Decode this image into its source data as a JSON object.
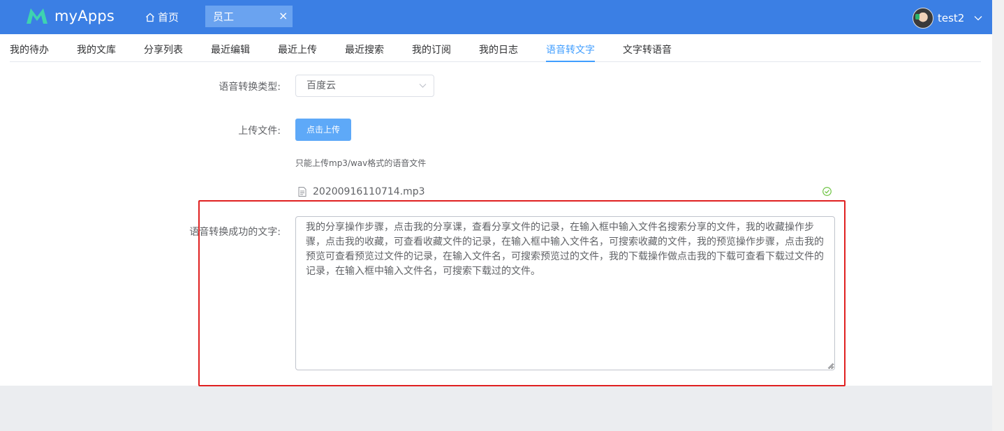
{
  "header": {
    "logo_text": "myApps",
    "home_label": "首页",
    "active_tab": "员工",
    "close_glyph": "×",
    "username": "test2",
    "colors": {
      "bar": "#3b7fe4",
      "active_tab": "#6aa3f0",
      "logo_mark": "#3ed3b0"
    }
  },
  "nav": {
    "tabs": [
      {
        "label": "我的待办"
      },
      {
        "label": "我的文库"
      },
      {
        "label": "分享列表"
      },
      {
        "label": "最近编辑"
      },
      {
        "label": "最近上传"
      },
      {
        "label": "最近搜索"
      },
      {
        "label": "我的订阅"
      },
      {
        "label": "我的日志"
      },
      {
        "label": "语音转文字",
        "active": true
      },
      {
        "label": "文字转语音"
      }
    ],
    "active_color": "#409eff"
  },
  "form": {
    "type_label": "语音转换类型:",
    "type_value": "百度云",
    "upload_label": "上传文件:",
    "upload_button": "点击上传",
    "upload_tip": "只能上传mp3/wav格式的语音文件",
    "file_name": "20200916110714.mp3",
    "file_status_icon": "check-circle-icon",
    "result_label": "语音转换成功的文字:",
    "result_text": "我的分享操作步骤，点击我的分享课，查看分享文件的记录，在输入框中输入文件名搜索分享的文件，我的收藏操作步骤，点击我的收藏，可查看收藏文件的记录，在输入框中输入文件名，可搜索收藏的文件，我的预览操作步骤，点击我的预览可查看预览过文件的记录，在输入文件名，可搜索预览过的文件，我的下载操作做点击我的下载可查看下载过文件的记录，在输入框中输入文件名，可搜索下载过的文件。"
  },
  "annotation": {
    "highlight_color": "#e02020"
  }
}
